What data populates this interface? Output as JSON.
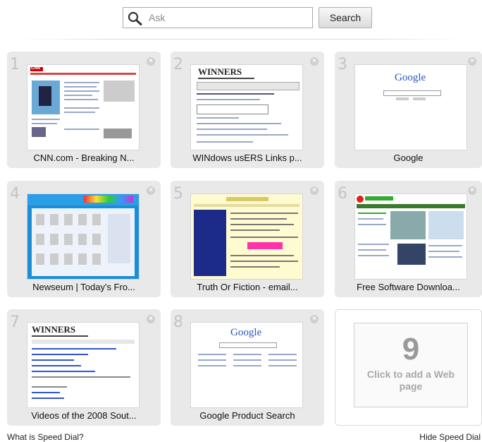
{
  "search": {
    "placeholder": "Ask",
    "button_label": "Search"
  },
  "tiles": [
    {
      "number": "1",
      "label": "CNN.com - Breaking N...",
      "thumb_logo": "CNN"
    },
    {
      "number": "2",
      "label": "WINdows usERS Links p...",
      "thumb_logo": "WINNERS"
    },
    {
      "number": "3",
      "label": "Google",
      "thumb_logo": "Google"
    },
    {
      "number": "4",
      "label": "Newseum | Today's Fro...",
      "thumb_logo": ""
    },
    {
      "number": "5",
      "label": "Truth Or Fiction - email...",
      "thumb_logo": ""
    },
    {
      "number": "6",
      "label": "Free Software Downloa...",
      "thumb_logo": ""
    },
    {
      "number": "7",
      "label": "Videos of the 2008 Sout...",
      "thumb_logo": "WINNERS"
    },
    {
      "number": "8",
      "label": "Google Product Search",
      "thumb_logo": "Google"
    }
  ],
  "empty_tile": {
    "number": "9",
    "text": "Click to add a Web page"
  },
  "footer": {
    "left_link": "What is Speed Dial?",
    "right_link": "Hide Speed Dial"
  },
  "icons": {
    "search": "search-icon",
    "close": "close-icon"
  }
}
